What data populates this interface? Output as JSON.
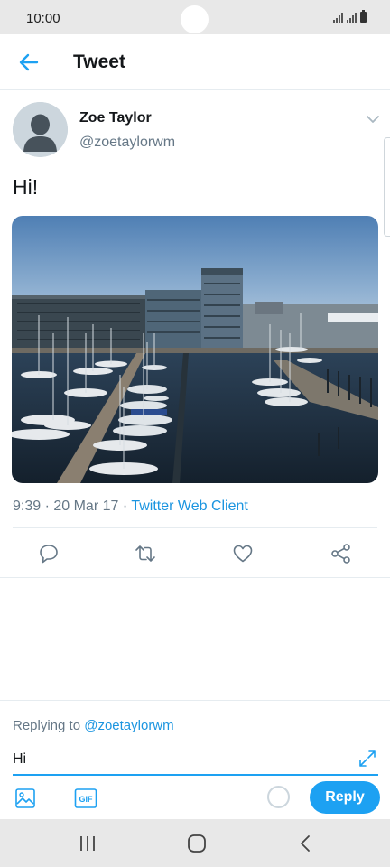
{
  "status_bar": {
    "time": "10:00"
  },
  "header": {
    "title": "Tweet",
    "back_icon": "arrow-left-icon"
  },
  "tweet": {
    "display_name": "Zoe Taylor",
    "handle": "@zoetaylorwm",
    "text": "Hi!",
    "timestamp": "9:39 · 20 Mar 17 · ",
    "client": "Twitter Web Client",
    "menu_icon": "chevron-down-icon"
  },
  "actions": [
    {
      "name": "reply",
      "icon": "comment-icon"
    },
    {
      "name": "retweet",
      "icon": "retweet-icon"
    },
    {
      "name": "like",
      "icon": "heart-icon"
    },
    {
      "name": "share",
      "icon": "share-icon"
    }
  ],
  "composer": {
    "replying_prefix": "Replying to ",
    "replying_to": "@zoetaylorwm",
    "input_value": "Hi",
    "reply_button": "Reply"
  },
  "colors": {
    "accent": "#1da1f2",
    "link": "#1b95e0",
    "secondary_text": "#657786",
    "system_bar": "#e8e8e8"
  }
}
